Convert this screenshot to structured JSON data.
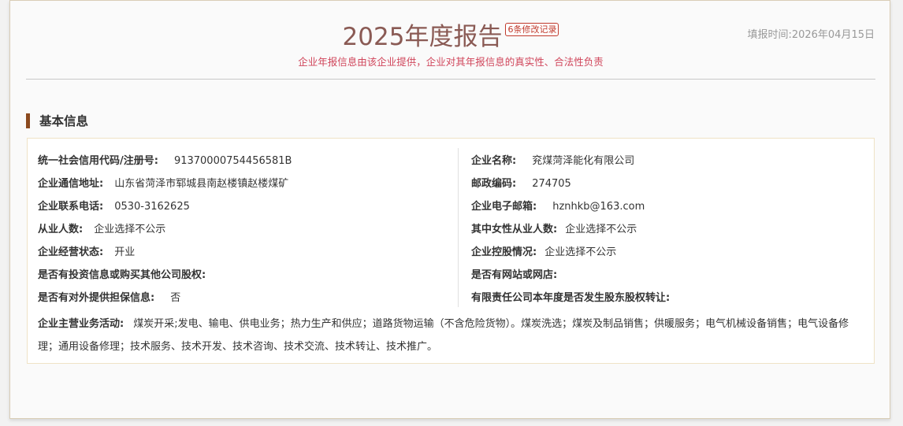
{
  "header": {
    "title": "2025年度报告",
    "revision_badge": "6条修改记录",
    "fill_time": "填报时间:2026年04月15日",
    "disclaimer": "企业年报信息由该企业提供，企业对其年报信息的真实性、合法性负责"
  },
  "section": {
    "title": "基本信息"
  },
  "basic_info": {
    "credit_code": {
      "label": "统一社会信用代码/注册号:",
      "value": "91370000754456581B"
    },
    "company_name": {
      "label": "企业名称:",
      "value": "兖煤菏泽能化有限公司"
    },
    "address": {
      "label": "企业通信地址:",
      "value": "山东省菏泽市郓城县南赵楼镇赵楼煤矿"
    },
    "postal_code": {
      "label": "邮政编码:",
      "value": "274705"
    },
    "phone": {
      "label": "企业联系电话:",
      "value": "0530-3162625"
    },
    "email": {
      "label": "企业电子邮箱:",
      "value": "hznhkb@163.com"
    },
    "employees": {
      "label": "从业人数:",
      "value": "企业选择不公示"
    },
    "female_employees": {
      "label": "其中女性从业人数:",
      "value": "企业选择不公示"
    },
    "status": {
      "label": "企业经营状态:",
      "value": "开业"
    },
    "holding": {
      "label": "企业控股情况:",
      "value": "企业选择不公示"
    },
    "investment": {
      "label": "是否有投资信息或购买其他公司股权:",
      "value": ""
    },
    "website": {
      "label": "是否有网站或网店:",
      "value": ""
    },
    "guarantee": {
      "label": "是否有对外提供担保信息:",
      "value": "否"
    },
    "equity_transfer": {
      "label": "有限责任公司本年度是否发生股东股权转让:",
      "value": ""
    },
    "business_scope": {
      "label": "企业主营业务活动:",
      "value": "煤炭开采;发电、输电、供电业务；热力生产和供应；道路货物运输（不含危险货物）。煤炭洗选；煤炭及制品销售；供暖服务；电气机械设备销售；电气设备修理；通用设备修理；技术服务、技术开发、技术咨询、技术交流、技术转让、技术推广。"
    }
  },
  "colors": {
    "title": "#8a5a54",
    "disclaimer": "#d0465b",
    "badge": "#c0392b",
    "section_bar": "#8b4a1f",
    "box_border": "#efe2c6"
  }
}
